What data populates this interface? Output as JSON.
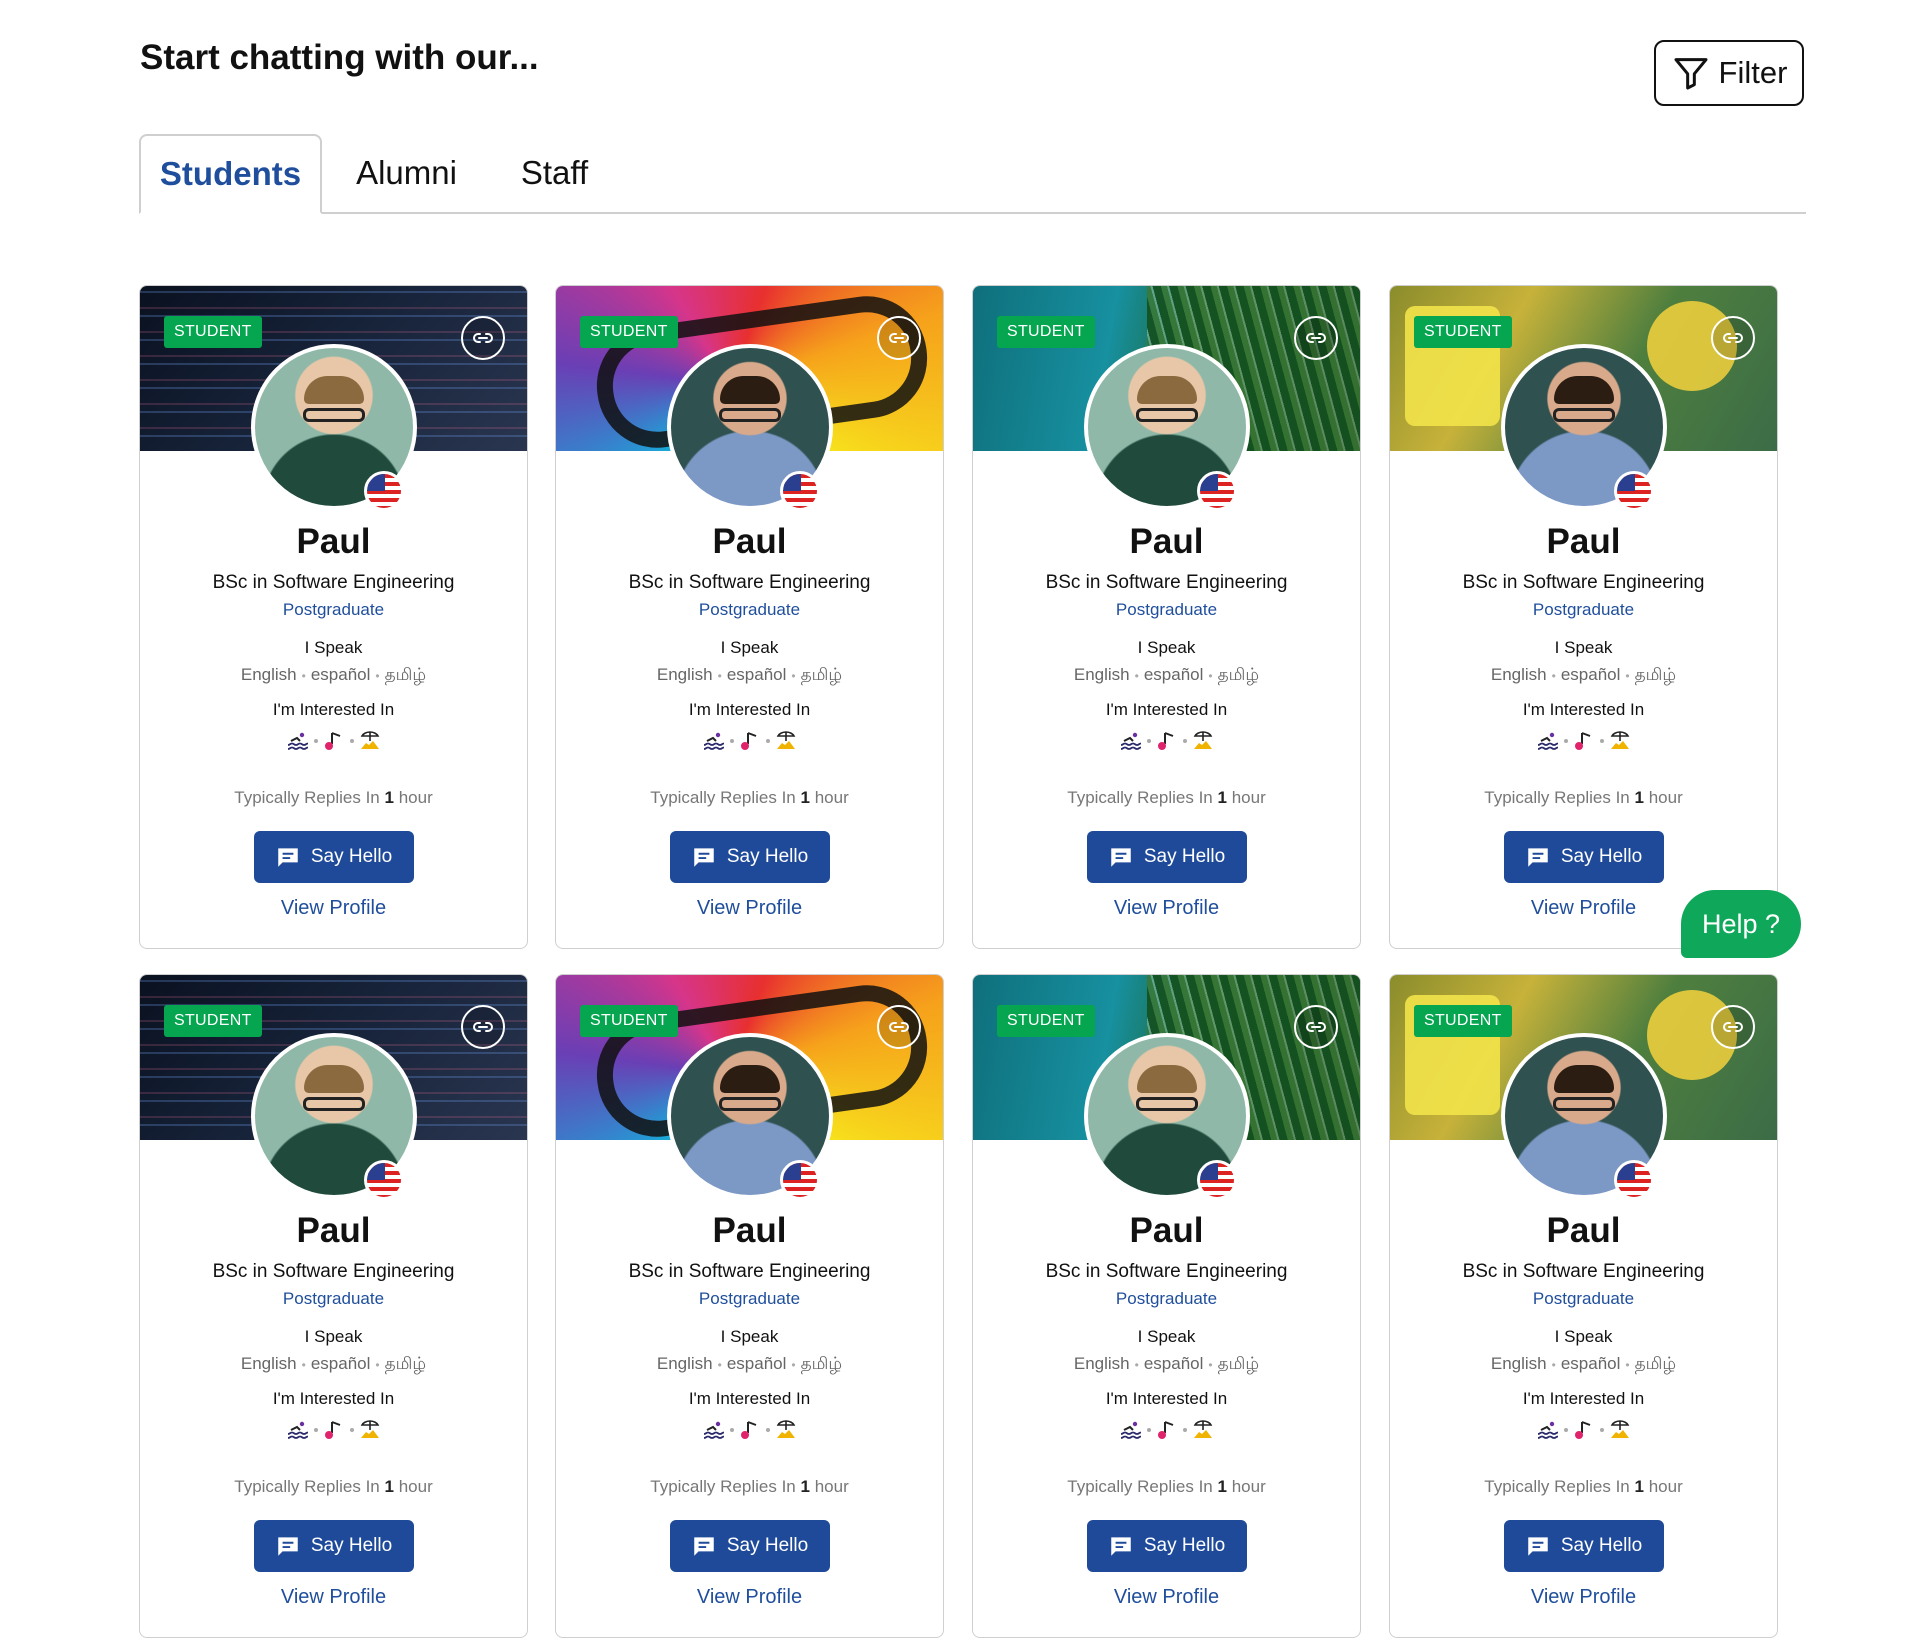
{
  "header": {
    "title": "Start chatting with our...",
    "filter_label": "Filter"
  },
  "tabs": [
    {
      "label": "Students"
    },
    {
      "label": "Alumni"
    },
    {
      "label": "Staff"
    }
  ],
  "card": {
    "badge": "STUDENT",
    "name": "Paul",
    "degree": "BSc in Software Engineering",
    "level": "Postgraduate",
    "speak_heading": "I Speak",
    "languages": [
      "English",
      "español",
      "தமிழ்"
    ],
    "interest_heading": "I'm Interested In",
    "interests": [
      "swimming-icon",
      "music-note-icon",
      "beach-icon"
    ],
    "reply_prefix": "Typically Replies In",
    "reply_value": "1",
    "reply_unit": "hour",
    "hello_label": "Say Hello",
    "view_label": "View Profile"
  },
  "covers": [
    "code",
    "music",
    "beach",
    "cartoon"
  ],
  "colors": {
    "accent": "#1e4a99",
    "badge": "#06a550",
    "help": "#0fa85a"
  },
  "help": {
    "label": "Help ?"
  }
}
